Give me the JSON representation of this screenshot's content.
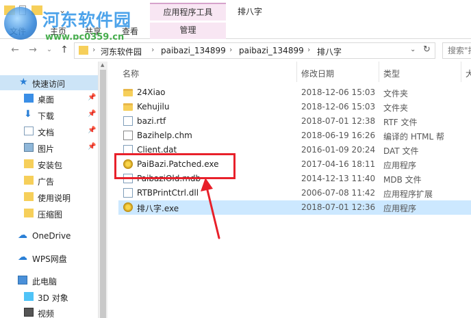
{
  "title_bar": {
    "app_tools_tab": "应用程序工具",
    "window_title": "排八字"
  },
  "watermark": {
    "title": "河东软件园",
    "url": "www.pc0359.cn"
  },
  "ribbon": {
    "tabs": [
      "文件",
      "主页",
      "共享",
      "查看"
    ],
    "manage_tab": "管理"
  },
  "address": {
    "crumbs": [
      "河东软件园",
      "paibazi_134899",
      "paibazi_134899",
      "排八字"
    ]
  },
  "search": {
    "placeholder": "搜索\"排"
  },
  "sidebar": {
    "items": [
      {
        "label": "快速访问",
        "icon": "star-icon"
      },
      {
        "label": "桌面",
        "icon": "desktop-icon"
      },
      {
        "label": "下载",
        "icon": "download-icon"
      },
      {
        "label": "文档",
        "icon": "document-icon"
      },
      {
        "label": "图片",
        "icon": "picture-icon"
      },
      {
        "label": "安装包",
        "icon": "folder-icon"
      },
      {
        "label": "广告",
        "icon": "folder-icon"
      },
      {
        "label": "使用说明",
        "icon": "folder-icon"
      },
      {
        "label": "压缩图",
        "icon": "folder-icon"
      },
      {
        "label": "OneDrive",
        "icon": "cloud-icon"
      },
      {
        "label": "WPS网盘",
        "icon": "cloud-icon"
      },
      {
        "label": "此电脑",
        "icon": "computer-icon"
      },
      {
        "label": "3D 对象",
        "icon": "cube-icon"
      },
      {
        "label": "视频",
        "icon": "video-icon"
      }
    ]
  },
  "columns": {
    "name": "名称",
    "date": "修改日期",
    "type": "类型",
    "size": "大"
  },
  "files": [
    {
      "name": "24Xiao",
      "date": "2018-12-06 15:03",
      "type": "文件夹",
      "icon": "folder-icon"
    },
    {
      "name": "Kehujilu",
      "date": "2018-12-06 15:03",
      "type": "文件夹",
      "icon": "folder-icon"
    },
    {
      "name": "bazi.rtf",
      "date": "2018-07-01 12:38",
      "type": "RTF 文件",
      "icon": "rtf-file-icon"
    },
    {
      "name": "Bazihelp.chm",
      "date": "2018-06-19 16:26",
      "type": "编译的 HTML 帮",
      "icon": "help-file-icon"
    },
    {
      "name": "Client.dat",
      "date": "2016-01-09 20:24",
      "type": "DAT 文件",
      "icon": "file-icon"
    },
    {
      "name": "PaiBazi.Patched.exe",
      "date": "2017-04-16 18:11",
      "type": "应用程序",
      "icon": "exe-icon"
    },
    {
      "name": "PaibaziOld.mdb",
      "date": "2014-12-13 11:40",
      "type": "MDB 文件",
      "icon": "file-icon"
    },
    {
      "name": "RTBPrintCtrl.dll",
      "date": "2006-07-08 11:42",
      "type": "应用程序扩展",
      "icon": "dll-file-icon"
    },
    {
      "name": "排八字.exe",
      "date": "2018-07-01 12:36",
      "type": "应用程序",
      "icon": "exe-icon"
    }
  ],
  "colors": {
    "selection": "#cce8ff",
    "highlight_box": "#e8202a",
    "app_tools_tab": "#f8e6f3"
  }
}
